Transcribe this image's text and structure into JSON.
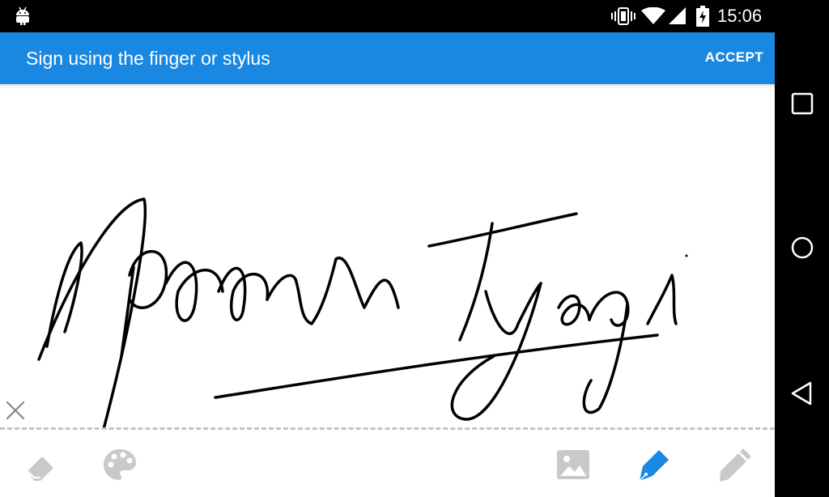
{
  "status_bar": {
    "time": "15:06",
    "icons": [
      "android-icon",
      "vibrate-icon",
      "wifi-icon",
      "signal-icon",
      "battery-charging-icon"
    ]
  },
  "app_bar": {
    "title": "Sign using the finger or stylus",
    "accept_label": "ACCEPT",
    "color": "#1a87e0"
  },
  "canvas": {
    "signature_text": "Apoorva Tyagi",
    "clear_icon": "close-icon"
  },
  "toolbar": {
    "tools": [
      "eraser-icon",
      "palette-icon",
      "image-icon",
      "pen-icon",
      "pencil-icon"
    ],
    "active_tool": "pen-icon",
    "active_color": "#1a87e0",
    "inactive_color": "#c9c9c9"
  },
  "nav_bar": {
    "buttons": [
      "recents-icon",
      "home-icon",
      "back-icon"
    ]
  }
}
